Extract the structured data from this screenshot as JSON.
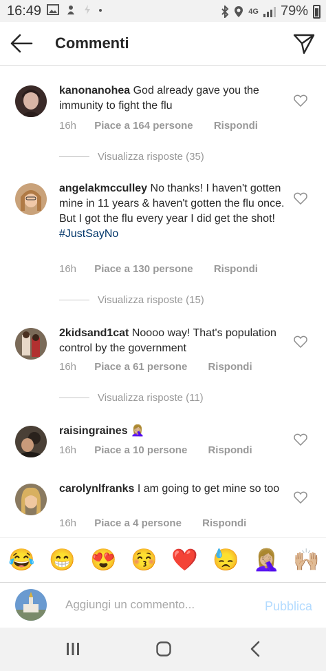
{
  "status_bar": {
    "time": "16:49",
    "network": "4G",
    "battery": "79%"
  },
  "header": {
    "title": "Commenti"
  },
  "comments": [
    {
      "username": "kanonanohea",
      "text": "God already gave you the immunity to fight the flu",
      "hashtag": "",
      "time": "16h",
      "likes": "Piace a 164 persone",
      "reply": "Rispondi",
      "view_replies": "Visualizza risposte (35)"
    },
    {
      "username": "angelakmcculley",
      "text": "No thanks! I haven't gotten mine in 11 years & haven't gotten the flu once. But I got the flu every year I did get the shot!",
      "hashtag": "#JustSayNo",
      "time": "16h",
      "likes": "Piace a 130 persone",
      "reply": "Rispondi",
      "view_replies": "Visualizza risposte (15)"
    },
    {
      "username": "2kidsand1cat",
      "text": "Noooo way!  That's population control by the government",
      "hashtag": "",
      "time": "16h",
      "likes": "Piace a 61 persone",
      "reply": "Rispondi",
      "view_replies": "Visualizza risposte (11)"
    },
    {
      "username": "raisingraines",
      "text": "🤦🏼‍♀️",
      "hashtag": "",
      "time": "16h",
      "likes": "Piace a 10 persone",
      "reply": "Rispondi",
      "view_replies": ""
    },
    {
      "username": "carolynlfranks",
      "text": "I am going to get mine so too",
      "hashtag": "",
      "time": "16h",
      "likes": "Piace a 4 persone",
      "reply": "Rispondi",
      "view_replies": ""
    }
  ],
  "emoji_bar": [
    "😂",
    "😁",
    "😍",
    "😚",
    "❤️",
    "😓",
    "🤦🏼‍♀️",
    "🙌🏼"
  ],
  "comment_input": {
    "placeholder": "Aggiungi un commento...",
    "publish_label": "Pubblica"
  },
  "colors": {
    "text": "#262626",
    "meta": "#999999",
    "hashtag": "#003569",
    "publish_disabled": "#b3dbff"
  }
}
